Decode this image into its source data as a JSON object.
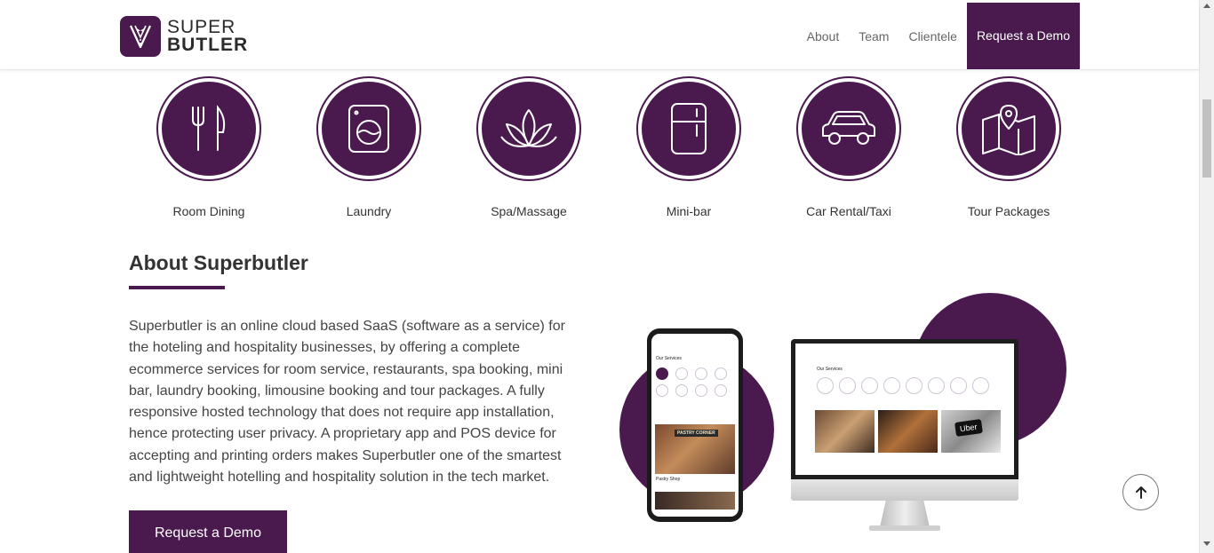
{
  "brand": {
    "line1": "SUPER",
    "line2": "BUTLER",
    "color": "#4a1a4f"
  },
  "nav": {
    "about": "About",
    "team": "Team",
    "clientele": "Clientele",
    "request_demo": "Request a Demo"
  },
  "services": [
    {
      "label": "Room Dining",
      "icon": "fork-knife-icon"
    },
    {
      "label": "Laundry",
      "icon": "washing-machine-icon"
    },
    {
      "label": "Spa/Massage",
      "icon": "lotus-icon"
    },
    {
      "label": "Mini-bar",
      "icon": "fridge-icon"
    },
    {
      "label": "Car Rental/Taxi",
      "icon": "car-icon"
    },
    {
      "label": "Tour Packages",
      "icon": "map-pin-icon"
    }
  ],
  "about": {
    "title": "About Superbutler",
    "text": "Superbutler is an online cloud based SaaS (software as a service) for the hoteling and hospitality businesses, by offering a complete ecommerce services for room service, restaurants, spa booking, mini bar, laundry booking, limousine booking and tour packages. A fully responsive hosted technology that does not require app installation, hence protecting user privacy. A proprietary app and POS device for accepting and printing orders makes Superbutler one of the smartest and lightweight hotelling and hospitality solution in the tech market.",
    "cta": "Request a Demo"
  },
  "mockup": {
    "phone_title": "Our Services",
    "phone_sign": "PASTRY CORNER",
    "phone_caption": "Pastry Shop",
    "monitor_title": "Our Services",
    "uber": "Uber"
  }
}
